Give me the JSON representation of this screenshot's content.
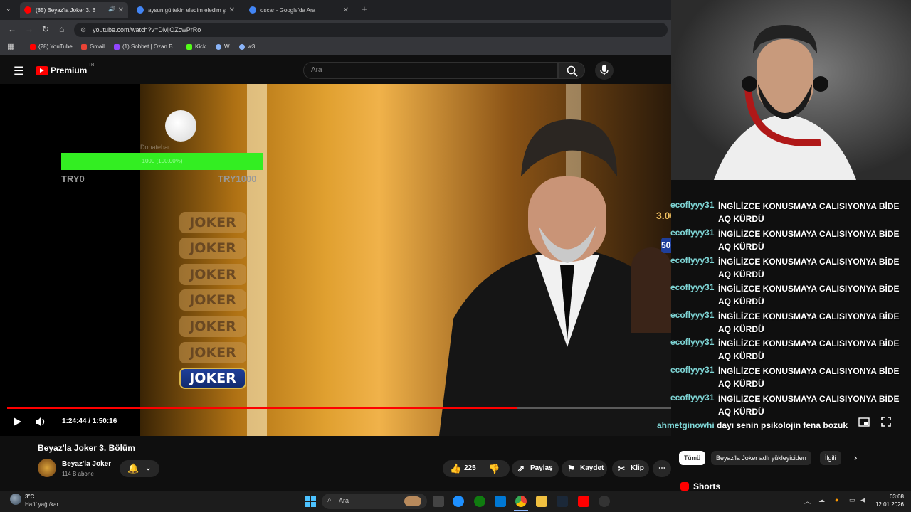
{
  "browser": {
    "tabs": [
      {
        "label": "(85) Beyaz'la Joker 3. Bölüm",
        "active": true
      },
      {
        "label": "aysun gültekin eledim eledim şarkı",
        "active": false
      },
      {
        "label": "oscar - Google'da Ara",
        "active": false
      }
    ],
    "url": "youtube.com/watch?v=DMjOZcwPrRo",
    "bookmarks": [
      "(28) YouTube",
      "Gmail",
      "(1) Sohbet | Ozan B...",
      "Kick",
      "W",
      "w3"
    ]
  },
  "youtube": {
    "logo_text": "Premium",
    "logo_badge": "TR",
    "search_placeholder": "Ara"
  },
  "overlay": {
    "donatebar_label": "Donatebar",
    "donatebar_progress": "1000 (100.00%)",
    "donate_min": "TRY0",
    "donate_max": "TRY1000",
    "joker_cards": [
      "JOKER",
      "JOKER",
      "JOKER",
      "JOKER",
      "JOKER",
      "JOKER",
      "JOKER"
    ],
    "prize_1": "3.000.000 TL",
    "prize_2": "500.000 TL"
  },
  "chat": [
    {
      "user": "ecoflyyy31",
      "message": "İNGİLİZCE KONUSMAYA CALISIYONYA BİDE AQ KÜRDÜ"
    },
    {
      "user": "ecoflyyy31",
      "message": "İNGİLİZCE KONUSMAYA CALISIYONYA BİDE AQ KÜRDÜ"
    },
    {
      "user": "ecoflyyy31",
      "message": "İNGİLİZCE KONUSMAYA CALISIYONYA BİDE AQ KÜRDÜ"
    },
    {
      "user": "ecoflyyy31",
      "message": "İNGİLİZCE KONUSMAYA CALISIYONYA BİDE AQ KÜRDÜ"
    },
    {
      "user": "ecoflyyy31",
      "message": "İNGİLİZCE KONUSMAYA CALISIYONYA BİDE AQ KÜRDÜ"
    },
    {
      "user": "ecoflyyy31",
      "message": "İNGİLİZCE KONUSMAYA CALISIYONYA BİDE AQ KÜRDÜ"
    },
    {
      "user": "ecoflyyy31",
      "message": "İNGİLİZCE KONUSMAYA CALISIYONYA BİDE AQ KÜRDÜ"
    },
    {
      "user": "ecoflyyy31",
      "message": "İNGİLİZCE KONUSMAYA CALISIYONYA BİDE AQ KÜRDÜ"
    },
    {
      "user": "ahmetginowhi",
      "message": "dayı senin psikolojin fena bozuk"
    }
  ],
  "player": {
    "time": "1:24:44 / 1:50:16",
    "progress_fraction": 0.768
  },
  "video_info": {
    "title": "Beyaz'la Joker 3. Bölüm",
    "channel": "Beyaz'la Joker",
    "subscribers": "114 B abone",
    "likes": "225",
    "share": "Paylaş",
    "save": "Kaydet",
    "clip": "Klip"
  },
  "sidebar": {
    "chips": [
      "Tümü",
      "Beyaz'la Joker adlı yükleyiciden",
      "İlgili"
    ],
    "shorts_label": "Shorts"
  },
  "taskbar": {
    "weather_temp": "3°C",
    "weather_desc": "Hafif yağ./kar",
    "search_label": "Ara",
    "time": "03:08",
    "date": "12.01.2026"
  },
  "colors": {
    "accent_red": "#ff0000",
    "chat_user": "#7fd6d6",
    "donate_green": "#33ee22"
  }
}
